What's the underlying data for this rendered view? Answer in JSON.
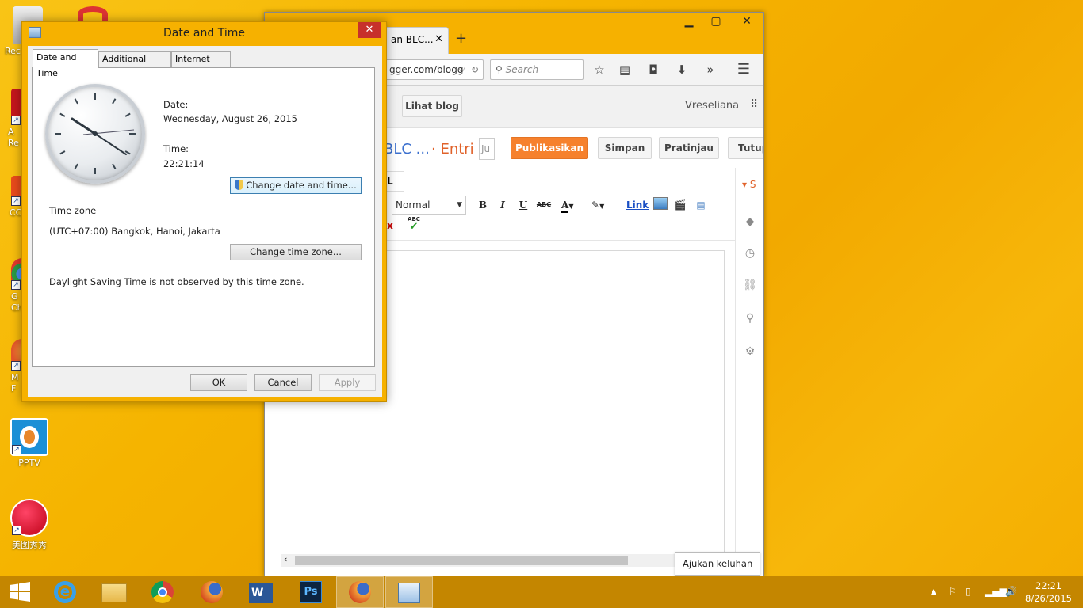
{
  "desktop": {
    "icons": [
      {
        "label": "Rec"
      },
      {
        "label": "A Re"
      },
      {
        "label": "CC"
      },
      {
        "label": "G Ch"
      },
      {
        "label": "M F"
      },
      {
        "label": "PPTV"
      },
      {
        "label": "美图秀秀"
      }
    ]
  },
  "browser": {
    "tab_title": "an BLC...",
    "url_partial": "gger.com/blogg",
    "search_placeholder": "Search",
    "view_blog_button": "Lihat blog",
    "account_name": "Vreseliana",
    "post_title_partial": "BLC ...",
    "entry_label": "· Entri",
    "title_input_partial": "Ju",
    "publish_button": "Publikasikan",
    "save_button": "Simpan",
    "preview_button": "Pratinjau",
    "close_button": "Tutup",
    "html_tab_partial": "L",
    "format_select": "Normal",
    "toolbar": {
      "bold": "B",
      "italic": "I",
      "underline": "U",
      "strike": "ABC",
      "link": "Link",
      "spell": "ABC"
    },
    "side_first_partial": "S"
  },
  "dialog": {
    "title": "Date and Time",
    "tabs": [
      "Date and Time",
      "Additional Clocks",
      "Internet Time"
    ],
    "date_label": "Date:",
    "date_value": "Wednesday, August 26, 2015",
    "time_label": "Time:",
    "time_value": "22:21:14",
    "change_datetime_button": "Change date and time...",
    "timezone_heading": "Time zone",
    "timezone_value": "(UTC+07:00) Bangkok, Hanoi, Jakarta",
    "change_timezone_button": "Change time zone...",
    "dst_note": "Daylight Saving Time is not observed by this time zone.",
    "ok_button": "OK",
    "cancel_button": "Cancel",
    "apply_button": "Apply"
  },
  "tooltip": "Ajukan keluhan",
  "taskbar": {
    "clock_time": "22:21",
    "clock_date": "8/26/2015"
  }
}
